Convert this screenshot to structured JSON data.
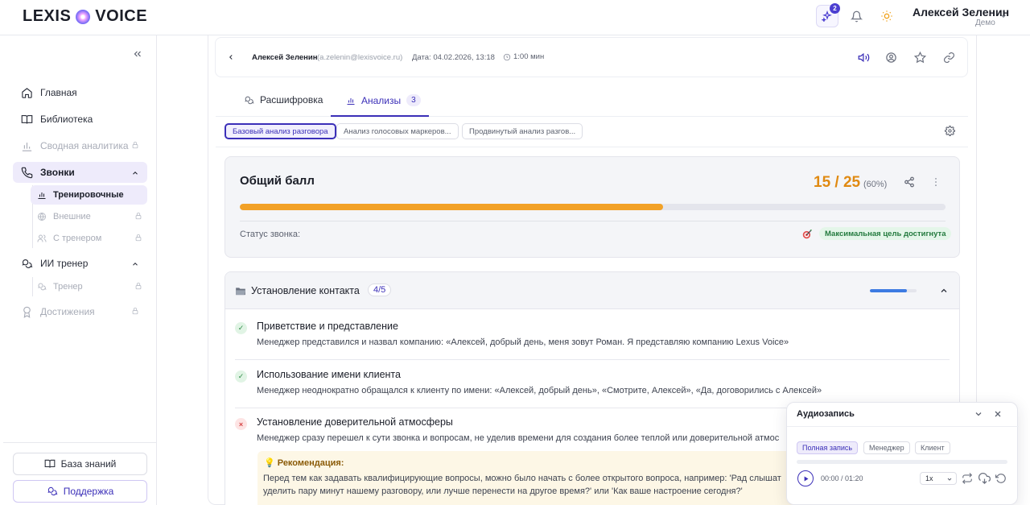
{
  "brand": {
    "left": "LEXIS",
    "right": "VOICE"
  },
  "header": {
    "ai_badge": "2",
    "user_name": "Алексей Зеленин",
    "user_role": "Демо"
  },
  "sidebar": {
    "items": [
      {
        "label": "Главная",
        "icon": "home-icon",
        "locked": false
      },
      {
        "label": "Библиотека",
        "icon": "book-icon",
        "locked": false
      },
      {
        "label": "Сводная аналитика",
        "icon": "chart-icon",
        "locked": true
      },
      {
        "label": "Звонки",
        "icon": "phone-icon",
        "active": true
      },
      {
        "label": "ИИ тренер",
        "icon": "chat-icon"
      },
      {
        "label": "Достижения",
        "icon": "award-icon",
        "locked": true
      }
    ],
    "calls_sub": [
      {
        "label": "Тренировочные",
        "active": true
      },
      {
        "label": "Внешние",
        "locked": true
      },
      {
        "label": "С тренером",
        "locked": true
      }
    ],
    "coach_sub": [
      {
        "label": "Тренер",
        "locked": true
      }
    ],
    "knowledge_base": "База знаний",
    "support": "Поддержка"
  },
  "call": {
    "manager": "Алексей Зеленин",
    "email": "(a.zelenin@lexisvoice.ru)",
    "date": "Дата: 04.02.2026, 13:18",
    "duration": "1:00 мин"
  },
  "tabs": {
    "transcript": "Расшифровка",
    "analyses": "Анализы",
    "analyses_count": "3"
  },
  "analysis_chips": [
    {
      "label": "Базовый анализ разговора",
      "active": true
    },
    {
      "label": "Анализ голосовых маркеров..."
    },
    {
      "label": "Продвинутый анализ разгов..."
    }
  ],
  "score": {
    "title": "Общий балл",
    "value": "15 / 25",
    "percent": "(60%)",
    "fill": 0.6,
    "status_label": "Статус звонка:",
    "status_badge": "Максимальная цель достигнута"
  },
  "section": {
    "title": "Установление контакта",
    "count": "4/5",
    "progress": 0.8,
    "criteria": [
      {
        "status": "ok",
        "mark": "✓",
        "title": "Приветствие и представление",
        "desc": "Менеджер представился и назвал компанию: «Алексей, добрый день, меня зовут Роман. Я представляю компанию Lexus Voice»"
      },
      {
        "status": "ok",
        "mark": "✓",
        "title": "Использование имени клиента",
        "desc": "Менеджер неоднократно обращался к клиенту по имени: «Алексей, добрый день», «Смотрите, Алексей», «Да, договорились с Алексей»"
      },
      {
        "status": "bad",
        "mark": "×",
        "title": "Установление доверительной атмосферы",
        "desc": "Менеджер сразу перешел к сути звонка и вопросам, не уделив времени для создания более теплой или доверительной атмос"
      }
    ],
    "recommendation_title": "💡 Рекомендация:",
    "recommendation_text": "Перед тем как задавать квалифицирующие вопросы, можно было начать с более открытого вопроса, например: 'Рад слышат уделить пару минут нашему разговору, или лучше перенести на другое время?' или 'Как ваше настроение сегодня?'"
  },
  "audio": {
    "title": "Аудиозапись",
    "chips": [
      "Полная запись",
      "Менеджер",
      "Клиент"
    ],
    "time": "00:00 / 01:20",
    "speed": "1x"
  }
}
